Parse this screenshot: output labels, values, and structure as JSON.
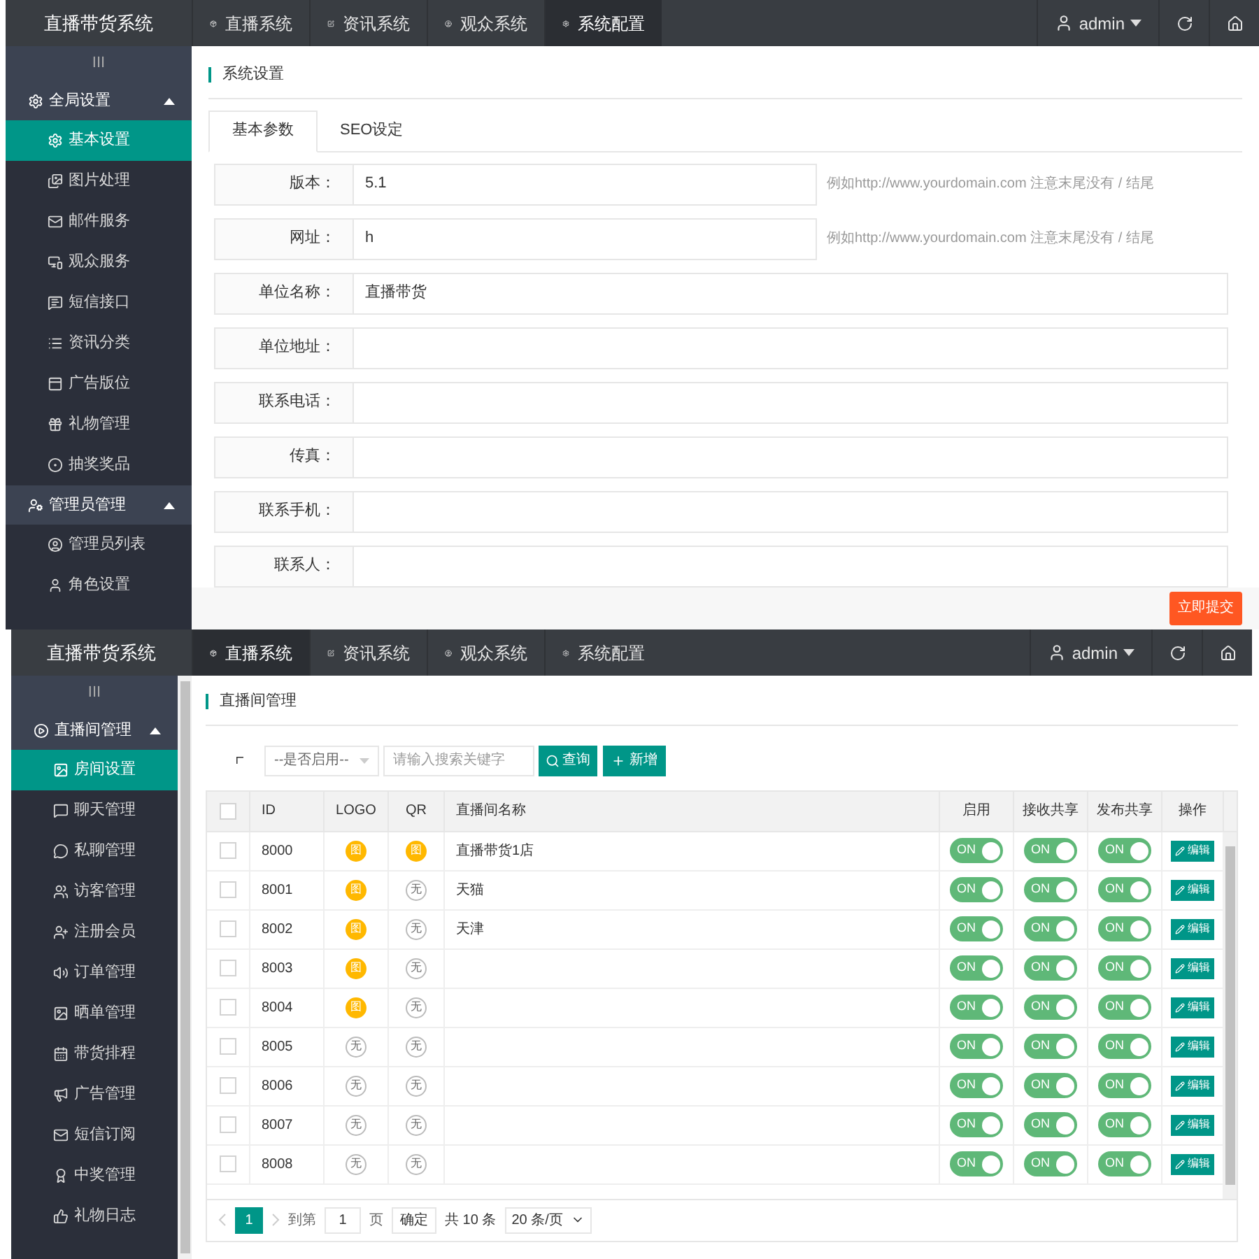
{
  "settings_screen": {
    "brand": "直播带货系统",
    "nav": [
      {
        "label": "直播系统",
        "selected": false
      },
      {
        "label": "资讯系统",
        "selected": false
      },
      {
        "label": "观众系统",
        "selected": false
      },
      {
        "label": "系统配置",
        "selected": true
      }
    ],
    "user": "admin",
    "sidebar_toggle": "III",
    "sidebar": [
      {
        "label": "全局设置",
        "expanded": true,
        "children": [
          {
            "label": "基本设置",
            "selected": true
          },
          {
            "label": "图片处理",
            "selected": false
          },
          {
            "label": "邮件服务",
            "selected": false
          },
          {
            "label": "观众服务",
            "selected": false
          },
          {
            "label": "短信接口",
            "selected": false
          },
          {
            "label": "资讯分类",
            "selected": false
          },
          {
            "label": "广告版位",
            "selected": false
          },
          {
            "label": "礼物管理",
            "selected": false
          },
          {
            "label": "抽奖奖品",
            "selected": false
          }
        ]
      },
      {
        "label": "管理员管理",
        "expanded": true,
        "children": [
          {
            "label": "管理员列表",
            "selected": false
          },
          {
            "label": "角色设置",
            "selected": false
          }
        ]
      }
    ],
    "page_title": "系统设置",
    "tabs": [
      {
        "label": "基本参数",
        "selected": true
      },
      {
        "label": "SEO设定",
        "selected": false
      }
    ],
    "fields": [
      {
        "label": "版本：",
        "value": "5.1",
        "hint": "例如http://www.yourdomain.com 注意末尾没有 / 结尾"
      },
      {
        "label": "网址：",
        "value": "h",
        "hint": "例如http://www.yourdomain.com 注意末尾没有 / 结尾"
      },
      {
        "label": "单位名称：",
        "value": "直播带货"
      },
      {
        "label": "单位地址："
      },
      {
        "label": "联系电话："
      },
      {
        "label": "传真："
      },
      {
        "label": "联系手机："
      },
      {
        "label": "联系人："
      }
    ],
    "submit": "立即提交"
  },
  "rooms_screen": {
    "brand": "直播带货系统",
    "nav": [
      {
        "label": "直播系统",
        "selected": true
      },
      {
        "label": "资讯系统",
        "selected": false
      },
      {
        "label": "观众系统",
        "selected": false
      },
      {
        "label": "系统配置",
        "selected": false
      }
    ],
    "user": "admin",
    "sidebar_toggle": "III",
    "sidebar": [
      {
        "label": "直播间管理",
        "expanded": true,
        "children": [
          {
            "label": "房间设置",
            "selected": true
          },
          {
            "label": "聊天管理",
            "selected": false
          },
          {
            "label": "私聊管理",
            "selected": false
          },
          {
            "label": "访客管理",
            "selected": false
          },
          {
            "label": "注册会员",
            "selected": false
          },
          {
            "label": "订单管理",
            "selected": false
          },
          {
            "label": "晒单管理",
            "selected": false
          },
          {
            "label": "带货排程",
            "selected": false
          },
          {
            "label": "广告管理",
            "selected": false
          },
          {
            "label": "短信订阅",
            "selected": false
          },
          {
            "label": "中奖管理",
            "selected": false
          },
          {
            "label": "礼物日志",
            "selected": false
          }
        ]
      }
    ],
    "page_title": "直播间管理",
    "filter_select": "--是否启用--",
    "search": {
      "placeholder": "请输入搜索关键字"
    },
    "query_button": "查询",
    "add_button": "新增",
    "table": {
      "select_all": {
        "checked": false
      },
      "columns": [
        "ID",
        "LOGO",
        "QR",
        "直播间名称",
        "启用",
        "接收共享",
        "发布共享",
        "操作"
      ],
      "rows": [
        {
          "checked": false,
          "id": "8000",
          "logo": {
            "label": "图",
            "set": true
          },
          "qr": {
            "label": "图",
            "set": true
          },
          "name": "直播带货1店",
          "enabled": {
            "label": "ON",
            "on": true
          },
          "receive": {
            "label": "ON",
            "on": true
          },
          "publish": {
            "label": "ON",
            "on": true
          },
          "action": "编辑"
        },
        {
          "checked": false,
          "id": "8001",
          "logo": {
            "label": "图",
            "set": true
          },
          "qr": {
            "label": "无",
            "set": false
          },
          "name": "天猫",
          "enabled": {
            "label": "ON",
            "on": true
          },
          "receive": {
            "label": "ON",
            "on": true
          },
          "publish": {
            "label": "ON",
            "on": true
          },
          "action": "编辑"
        },
        {
          "checked": false,
          "id": "8002",
          "logo": {
            "label": "图",
            "set": true
          },
          "qr": {
            "label": "无",
            "set": false
          },
          "name": "天津",
          "enabled": {
            "label": "ON",
            "on": true
          },
          "receive": {
            "label": "ON",
            "on": true
          },
          "publish": {
            "label": "ON",
            "on": true
          },
          "action": "编辑"
        },
        {
          "checked": false,
          "id": "8003",
          "logo": {
            "label": "图",
            "set": true
          },
          "qr": {
            "label": "无",
            "set": false
          },
          "enabled": {
            "label": "ON",
            "on": true
          },
          "receive": {
            "label": "ON",
            "on": true
          },
          "publish": {
            "label": "ON",
            "on": true
          },
          "action": "编辑"
        },
        {
          "checked": false,
          "id": "8004",
          "logo": {
            "label": "图",
            "set": true
          },
          "qr": {
            "label": "无",
            "set": false
          },
          "enabled": {
            "label": "ON",
            "on": true
          },
          "receive": {
            "label": "ON",
            "on": true
          },
          "publish": {
            "label": "ON",
            "on": true
          },
          "action": "编辑"
        },
        {
          "checked": false,
          "id": "8005",
          "logo": {
            "label": "无",
            "set": false
          },
          "qr": {
            "label": "无",
            "set": false
          },
          "enabled": {
            "label": "ON",
            "on": true
          },
          "receive": {
            "label": "ON",
            "on": true
          },
          "publish": {
            "label": "ON",
            "on": true
          },
          "action": "编辑"
        },
        {
          "checked": false,
          "id": "8006",
          "logo": {
            "label": "无",
            "set": false
          },
          "qr": {
            "label": "无",
            "set": false
          },
          "enabled": {
            "label": "ON",
            "on": true
          },
          "receive": {
            "label": "ON",
            "on": true
          },
          "publish": {
            "label": "ON",
            "on": true
          },
          "action": "编辑"
        },
        {
          "checked": false,
          "id": "8007",
          "logo": {
            "label": "无",
            "set": false
          },
          "qr": {
            "label": "无",
            "set": false
          },
          "enabled": {
            "label": "ON",
            "on": true
          },
          "receive": {
            "label": "ON",
            "on": true
          },
          "publish": {
            "label": "ON",
            "on": true
          },
          "action": "编辑"
        },
        {
          "checked": false,
          "id": "8008",
          "logo": {
            "label": "无",
            "set": false
          },
          "qr": {
            "label": "无",
            "set": false
          },
          "enabled": {
            "label": "ON",
            "on": true
          },
          "receive": {
            "label": "ON",
            "on": true
          },
          "publish": {
            "label": "ON",
            "on": true
          },
          "action": "编辑"
        }
      ]
    },
    "pagination": {
      "pages": [
        {
          "label": "1",
          "selected": true
        }
      ],
      "goto_label": "到第",
      "goto_value": "1",
      "page_unit": "页",
      "confirm": "确定",
      "total": "共 10 条",
      "page_size": "20 条/页"
    }
  }
}
